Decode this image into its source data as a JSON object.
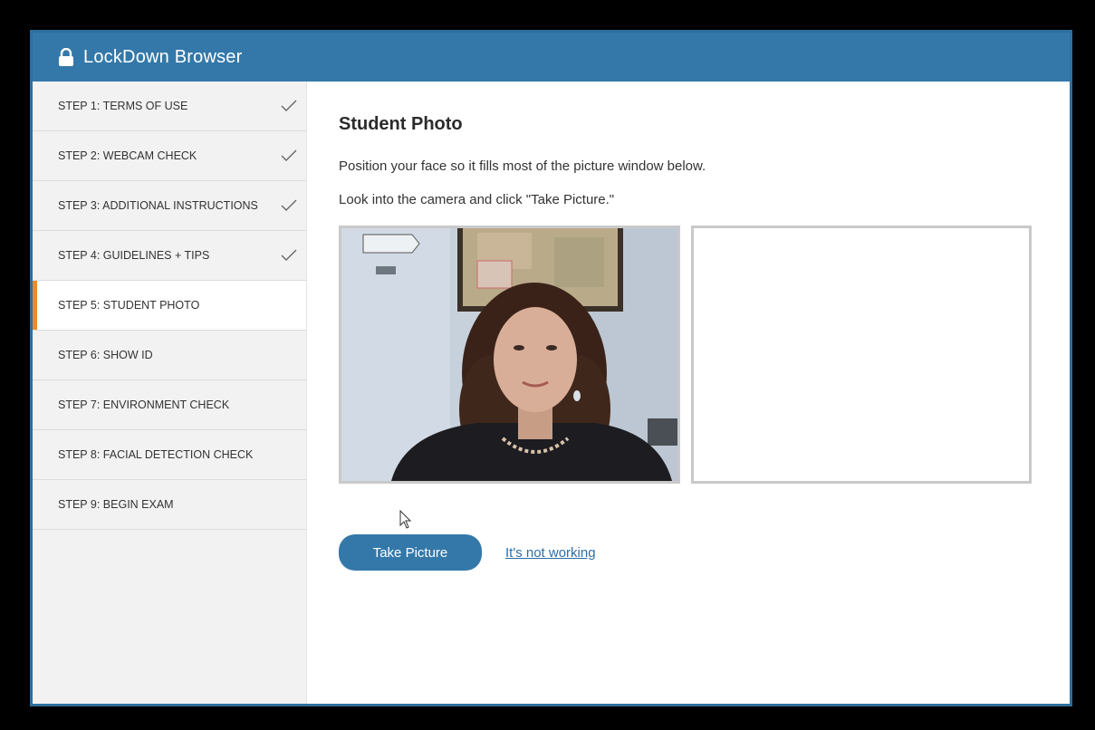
{
  "app": {
    "title": "LockDown Browser",
    "icon": "lock-icon"
  },
  "sidebar": {
    "steps": [
      {
        "label": "STEP 1: TERMS OF USE",
        "done": true
      },
      {
        "label": "STEP 2: WEBCAM CHECK",
        "done": true
      },
      {
        "label": "STEP 3: ADDITIONAL INSTRUCTIONS",
        "done": true
      },
      {
        "label": "STEP 4: GUIDELINES + TIPS",
        "done": true
      },
      {
        "label": "STEP 5: STUDENT PHOTO",
        "done": false,
        "active": true
      },
      {
        "label": "STEP 6: SHOW ID",
        "done": false
      },
      {
        "label": "STEP 7: ENVIRONMENT CHECK",
        "done": false
      },
      {
        "label": "STEP 8: FACIAL DETECTION CHECK",
        "done": false
      },
      {
        "label": "STEP 9: BEGIN EXAM",
        "done": false
      }
    ]
  },
  "main": {
    "title": "Student Photo",
    "instruction_1": "Position your face so it fills most of the picture window below.",
    "instruction_2": "Look into the camera and click \"Take Picture.\"",
    "take_picture_label": "Take Picture",
    "not_working_label": "It's not working"
  },
  "colors": {
    "header": "#3478a9",
    "active_marker": "#f08a24",
    "link": "#2e6ea8"
  }
}
